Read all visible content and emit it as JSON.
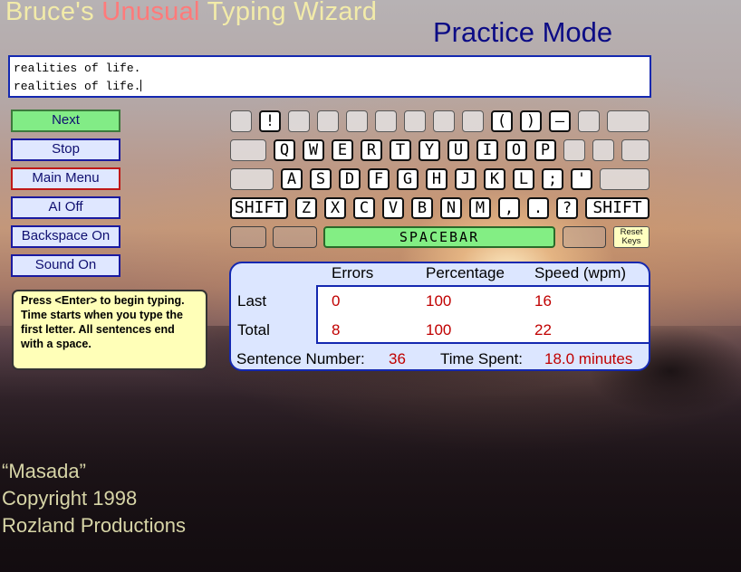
{
  "app": {
    "title_part1": "Bruce's ",
    "title_part2": "Unusual",
    "title_part3": " Typing Wizard",
    "mode": "Practice Mode"
  },
  "typing": {
    "target_line": "realities of life.",
    "typed_line": "realities of life."
  },
  "buttons": {
    "next": "Next",
    "stop": "Stop",
    "main_menu": "Main Menu",
    "ai": "AI Off",
    "backspace": "Backspace On",
    "sound": "Sound On"
  },
  "help_text": "Press <Enter> to begin typing. Time starts when you type the first letter. All sentences end with a space.",
  "keyboard": {
    "row1": [
      "",
      "!",
      "",
      "",
      "",
      "",
      "",
      "",
      "",
      "(",
      ")",
      "–",
      "",
      ""
    ],
    "row2": [
      "",
      "Q",
      "W",
      "E",
      "R",
      "T",
      "Y",
      "U",
      "I",
      "O",
      "P",
      "",
      "",
      ""
    ],
    "row3": [
      "",
      "A",
      "S",
      "D",
      "F",
      "G",
      "H",
      "J",
      "K",
      "L",
      ";",
      "'",
      ""
    ],
    "row4": [
      "SHIFT",
      "Z",
      "X",
      "C",
      "V",
      "B",
      "N",
      "M",
      ",",
      ".",
      "?",
      "SHIFT"
    ],
    "spacebar": "SPACEBAR",
    "reset_line1": "Reset",
    "reset_line2": "Keys"
  },
  "stats": {
    "headers": {
      "errors": "Errors",
      "percentage": "Percentage",
      "speed": "Speed (wpm)"
    },
    "last": {
      "label": "Last",
      "errors": "0",
      "percentage": "100",
      "speed": "16"
    },
    "total": {
      "label": "Total",
      "errors": "8",
      "percentage": "100",
      "speed": "22"
    },
    "sentence_label": "Sentence Number:",
    "sentence_number": "36",
    "time_label": "Time Spent:",
    "time_value": "18.0 minutes"
  },
  "credits": {
    "line1": "“Masada”",
    "line2": "Copyright 1998",
    "line3": "Rozland Productions"
  },
  "colors": {
    "title": "#f2eba9",
    "title_accent": "#ff7a7a",
    "mode": "#0c0c85",
    "spacebar": "#83ee84",
    "stat_values": "#c00000"
  }
}
